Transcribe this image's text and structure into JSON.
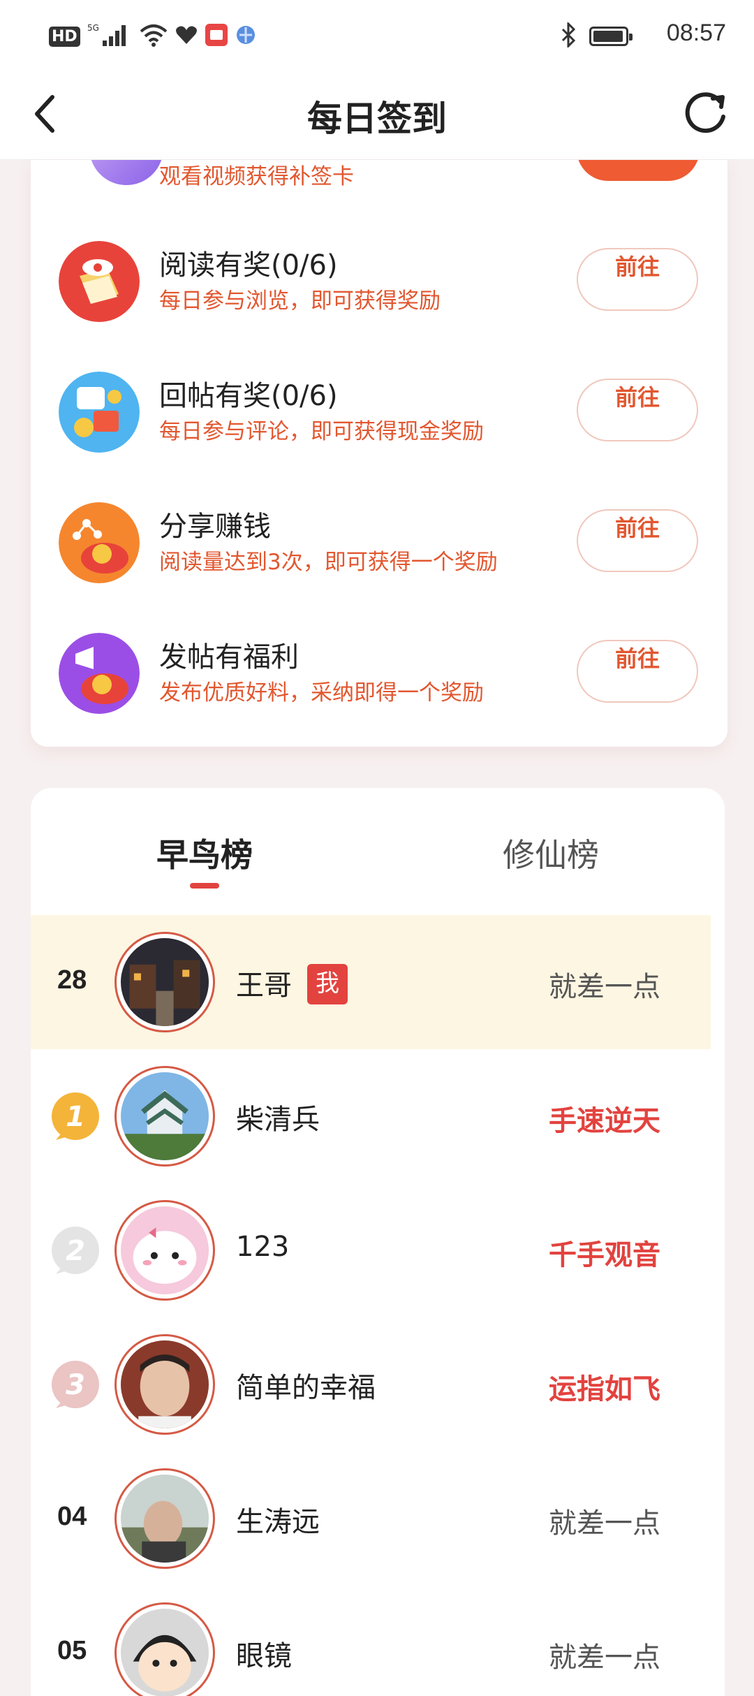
{
  "status_bar": {
    "time": "08:57",
    "hd_label": "HD",
    "network_label": "5G",
    "icons": [
      "hd-icon",
      "signal-icon",
      "wifi-icon",
      "heart-icon",
      "app-notification-icon",
      "browser-icon",
      "bluetooth-icon",
      "battery-icon"
    ]
  },
  "nav": {
    "title": "每日签到",
    "back_icon": "back-chevron-icon",
    "refresh_icon": "refresh-icon"
  },
  "tasks_top_partial": {
    "desc": "观看视频获得补签卡"
  },
  "tasks": [
    {
      "title": "阅读有奖(0/6)",
      "desc": "每日参与浏览，即可获得奖励",
      "button": "前往",
      "icon": "eye-book-icon"
    },
    {
      "title": "回帖有奖(0/6)",
      "desc": "每日参与评论，即可获得现金奖励",
      "button": "前往",
      "icon": "comment-gift-icon"
    },
    {
      "title": "分享赚钱",
      "desc": "阅读量达到3次，即可获得一个奖励",
      "button": "前往",
      "icon": "share-coin-icon"
    },
    {
      "title": "发帖有福利",
      "desc": "发布优质好料，采纳即得一个奖励",
      "button": "前往",
      "icon": "megaphone-coin-icon"
    }
  ],
  "ranking": {
    "tabs": [
      "早鸟榜",
      "修仙榜"
    ],
    "active_tab": 0,
    "me_badge": "我",
    "rows": [
      {
        "rank": "28",
        "name": "王哥",
        "status": "就差一点",
        "is_me": true
      },
      {
        "rank": "1",
        "name": "柴清兵",
        "status": "手速逆天",
        "medal": "gold"
      },
      {
        "rank": "2",
        "name": "123",
        "status": "千手观音",
        "medal": "silver"
      },
      {
        "rank": "3",
        "name": "简单的幸福",
        "status": "运指如飞",
        "medal": "bronze"
      },
      {
        "rank": "04",
        "name": "生涛远",
        "status": "就差一点"
      },
      {
        "rank": "05",
        "name": "眼镜",
        "status": "就差一点"
      }
    ]
  },
  "colors": {
    "accent": "#e2433f",
    "task_desc": "#e2572f",
    "me_row_bg": "#fdf6e2",
    "page_bg": "#f7f0f0"
  }
}
